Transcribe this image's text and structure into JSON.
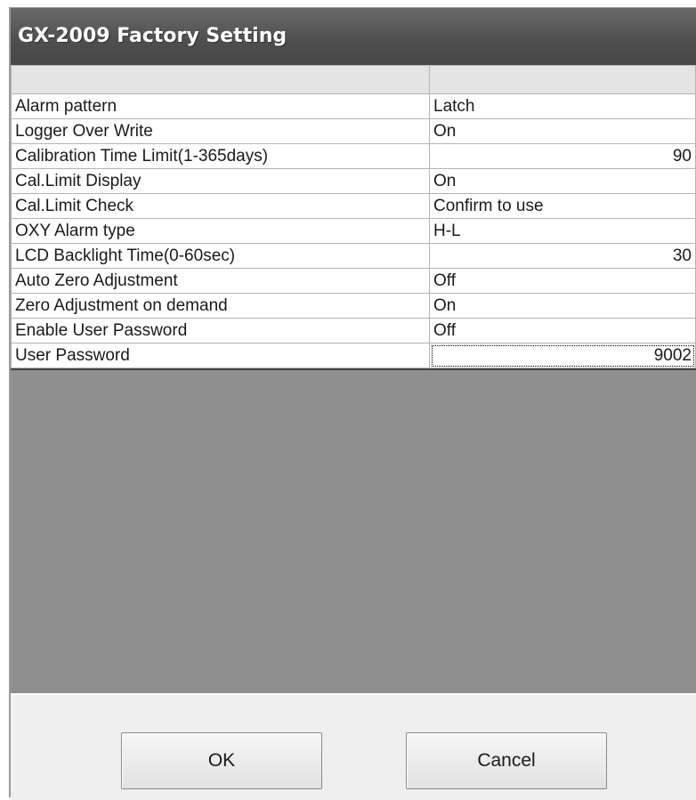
{
  "window": {
    "title": "GX-2009 Factory Setting"
  },
  "grid": {
    "rows": [
      {
        "name": "Alarm pattern",
        "value": "Latch",
        "align": "left"
      },
      {
        "name": "Logger Over Write",
        "value": "On",
        "align": "left"
      },
      {
        "name": "Calibration Time Limit(1-365days)",
        "value": "90",
        "align": "right"
      },
      {
        "name": "Cal.Limit Display",
        "value": "On",
        "align": "left"
      },
      {
        "name": "Cal.Limit Check",
        "value": "Confirm to use",
        "align": "left"
      },
      {
        "name": "OXY Alarm type",
        "value": "H-L",
        "align": "left"
      },
      {
        "name": "LCD Backlight Time(0-60sec)",
        "value": "30",
        "align": "right"
      },
      {
        "name": "Auto Zero Adjustment",
        "value": "Off",
        "align": "left"
      },
      {
        "name": "Zero Adjustment on demand",
        "value": "On",
        "align": "left"
      },
      {
        "name": "Enable User Password",
        "value": "Off",
        "align": "left"
      },
      {
        "name": "User Password",
        "value": "9002",
        "align": "right",
        "focused": true
      }
    ]
  },
  "buttons": {
    "ok_label": "OK",
    "cancel_label": "Cancel"
  }
}
